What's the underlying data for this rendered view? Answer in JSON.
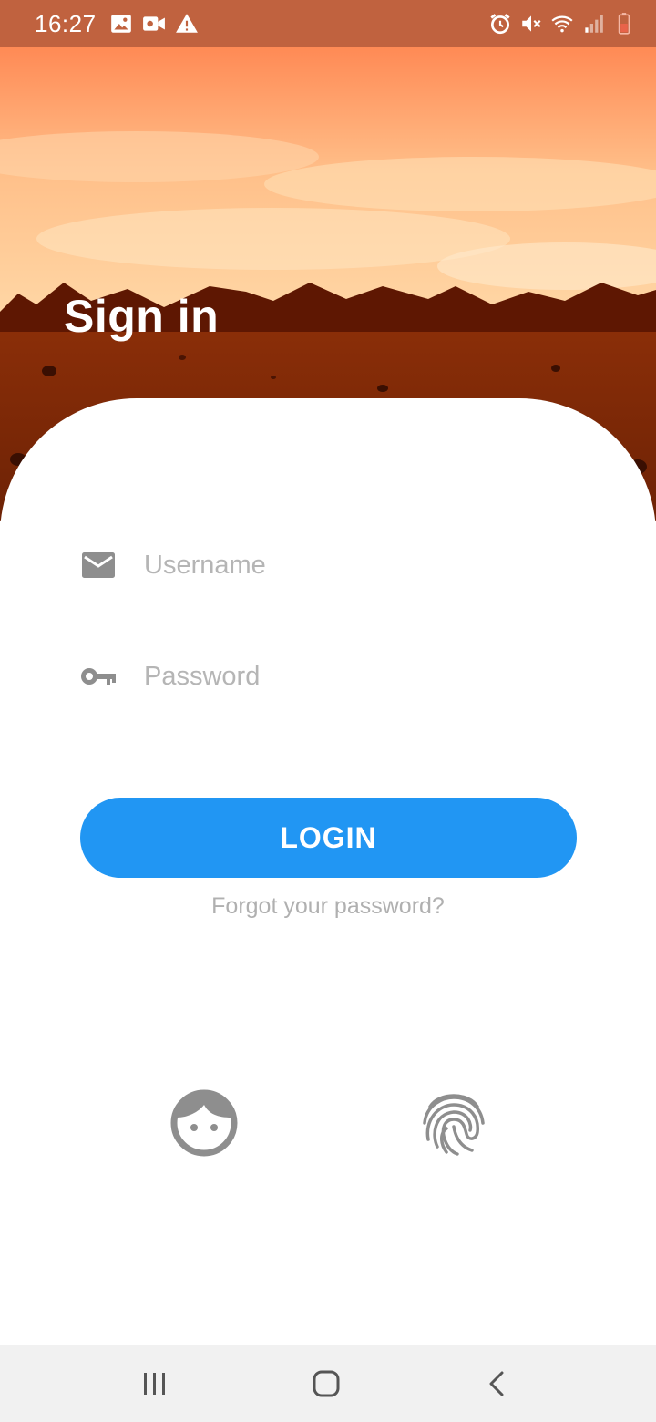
{
  "status_bar": {
    "time": "16:27",
    "left_icons": [
      "image-icon",
      "video-icon",
      "warning-icon"
    ],
    "right_icons": [
      "alarm-icon",
      "mute-icon",
      "wifi-icon",
      "signal-icon",
      "battery-icon"
    ]
  },
  "header": {
    "title": "Sign in"
  },
  "form": {
    "username_placeholder": "Username",
    "password_placeholder": "Password",
    "login_label": "LOGIN",
    "forgot_label": "Forgot your password?"
  },
  "biometrics": [
    "face-icon",
    "fingerprint-icon"
  ],
  "nav": [
    "recent-apps",
    "home",
    "back"
  ],
  "colors": {
    "accent": "#2196f3",
    "status_bar": "#c0623f",
    "placeholder": "#b5b5b5",
    "icon": "#8e8e8e"
  }
}
